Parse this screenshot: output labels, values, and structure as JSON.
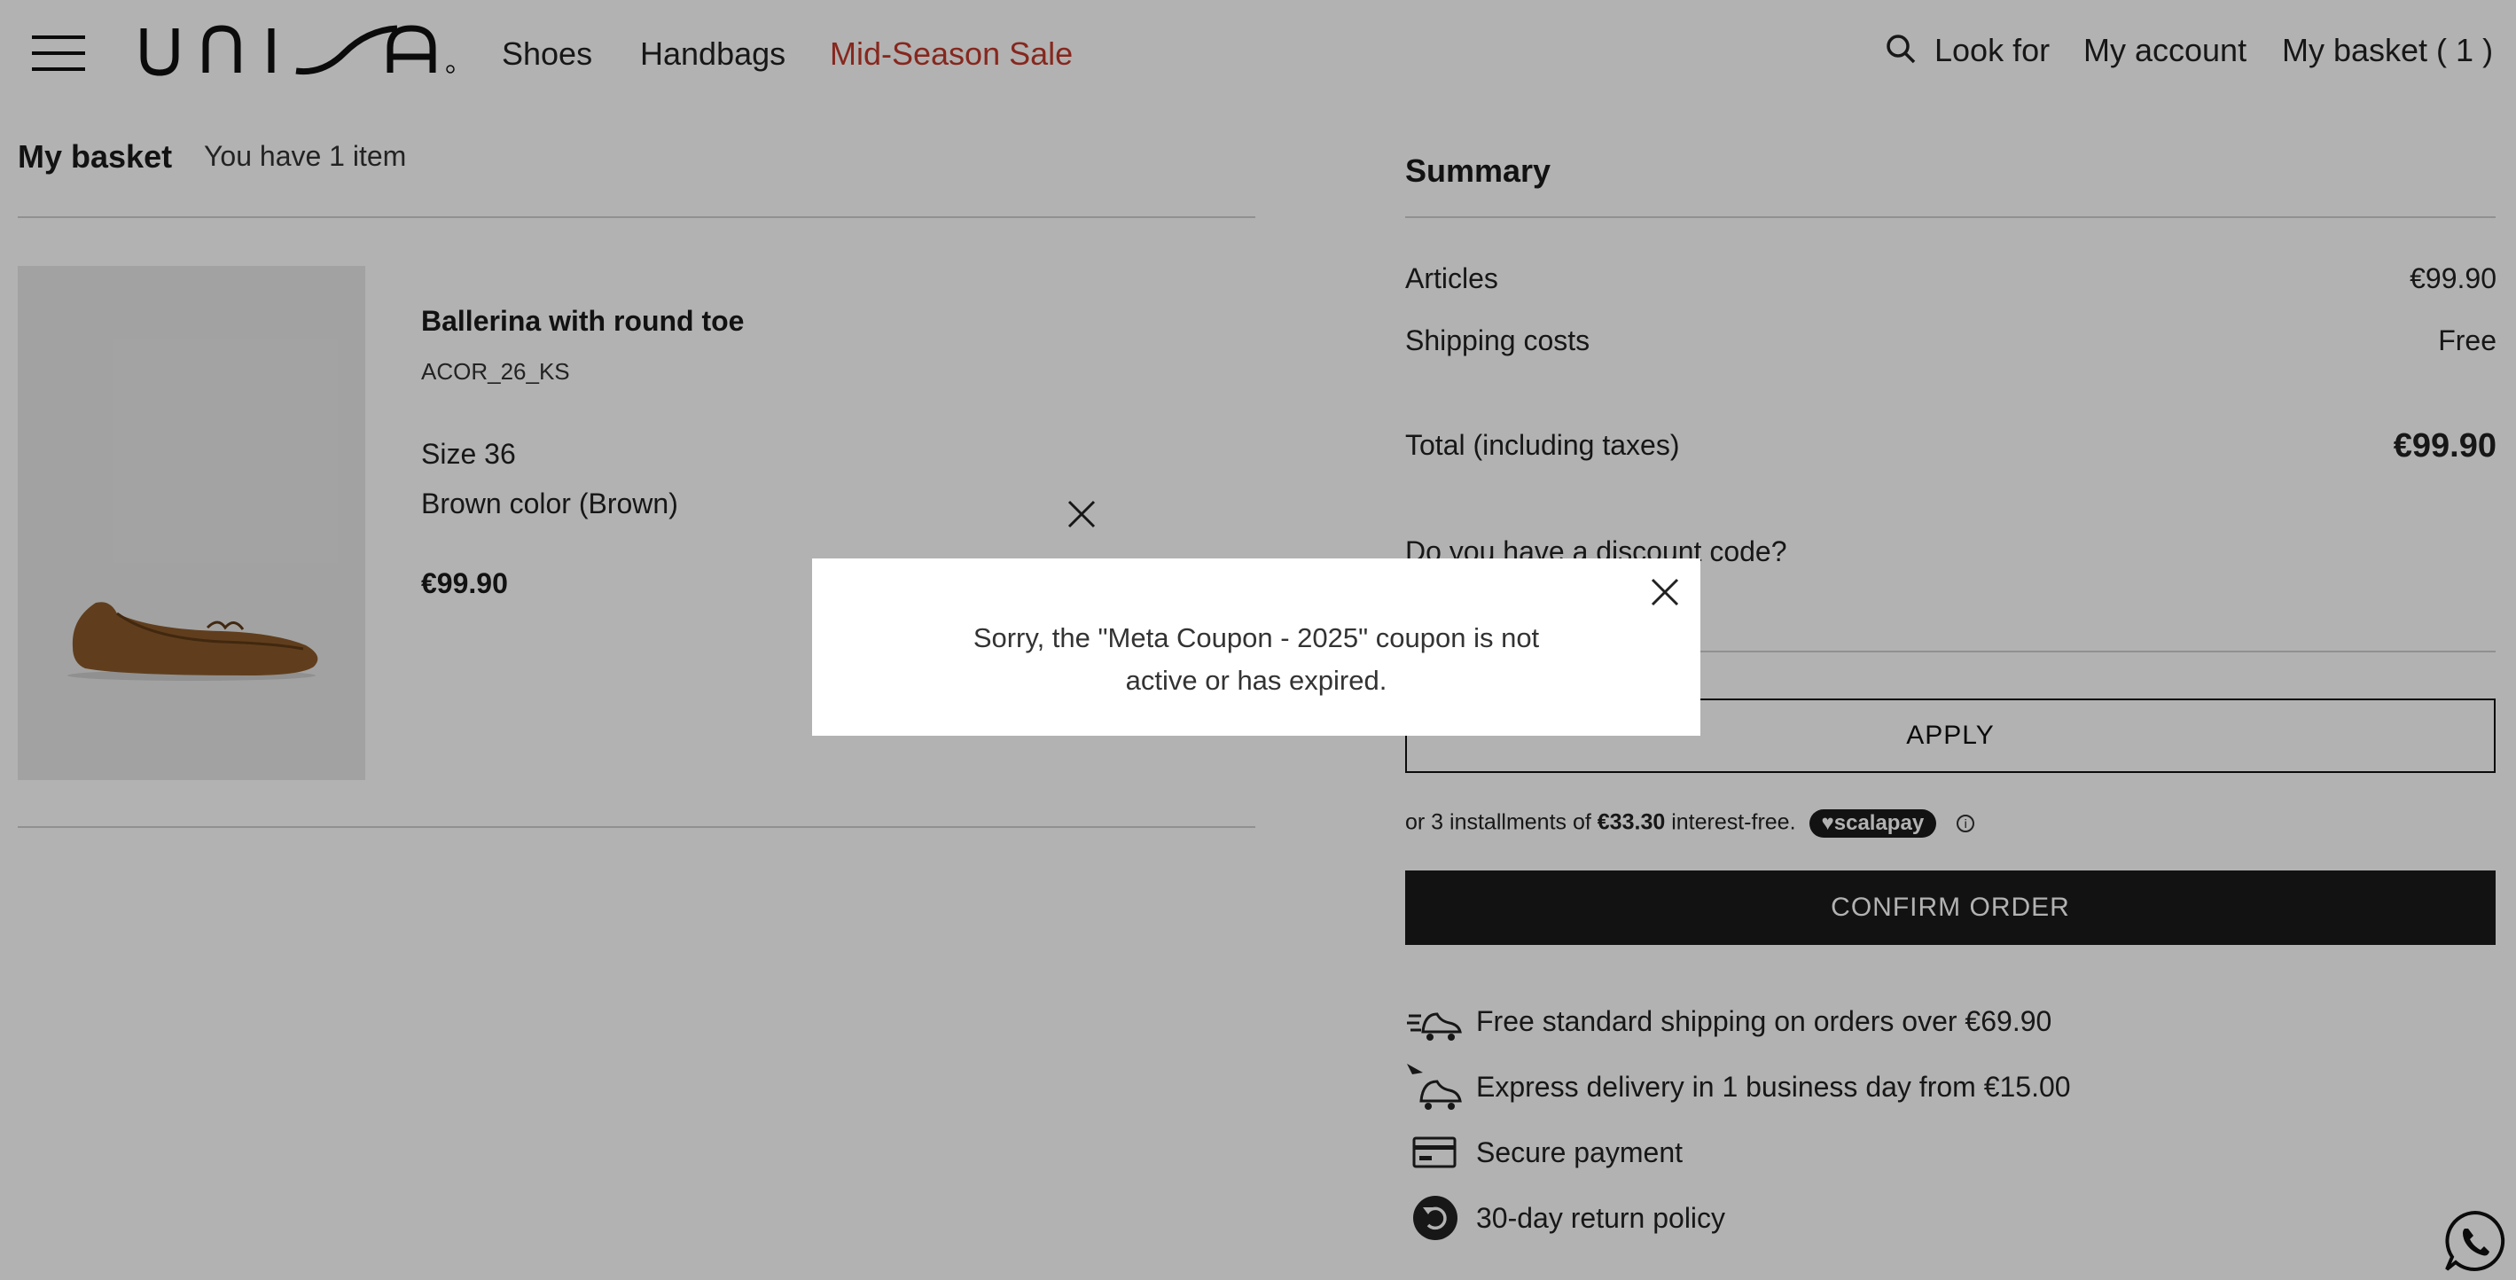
{
  "header": {
    "logo_text": "UNISA",
    "nav": {
      "shoes": "Shoes",
      "handbags": "Handbags",
      "sale": "Mid-Season Sale"
    },
    "search_label": "Look for",
    "account_label": "My account",
    "basket_label": "My basket ( 1 )"
  },
  "basket": {
    "title": "My basket",
    "count_text": "You have 1 item",
    "item": {
      "name": "Ballerina with round toe",
      "sku": "ACOR_26_KS",
      "size": "Size 36",
      "color": "Brown color (Brown)",
      "price": "€99.90"
    }
  },
  "summary": {
    "title": "Summary",
    "articles_label": "Articles",
    "articles_value": "€99.90",
    "shipping_label": "Shipping costs",
    "shipping_value": "Free",
    "total_label": "Total (including taxes)",
    "total_value": "€99.90",
    "discount_question": "Do you have a discount code?",
    "discount_value": "",
    "apply_label": "APPLY",
    "installments_prefix": "or 3 installments of",
    "installments_amount": "€33.30",
    "installments_suffix": "interest-free.",
    "scalapay_label": "♥scalapay",
    "confirm_label": "CONFIRM ORDER"
  },
  "perks": [
    {
      "icon": "free-shipping-icon",
      "text": "Free standard shipping on orders over €69.90"
    },
    {
      "icon": "express-delivery-icon",
      "text": "Express delivery in 1 business day from €15.00"
    },
    {
      "icon": "credit-card-icon",
      "text": "Secure payment"
    },
    {
      "icon": "return-icon",
      "text": "30-day return policy"
    }
  ],
  "modal": {
    "message": "Sorry, the \"Meta Coupon - 2025\" coupon is not active or has expired."
  },
  "colors": {
    "sale": "#c0392b",
    "confirm_bg": "#1a1a1a",
    "overlay": "rgba(0,0,0,0.30)"
  }
}
